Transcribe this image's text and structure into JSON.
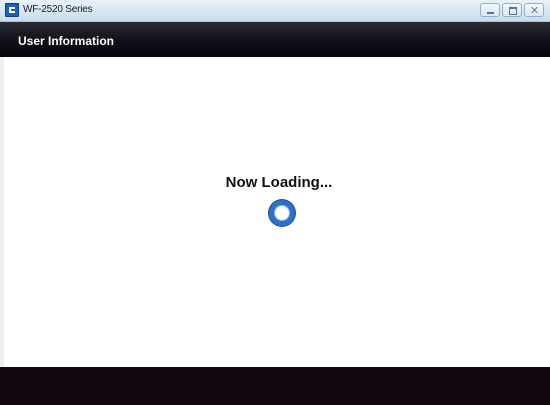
{
  "window": {
    "title": "WF-2520 Series",
    "controls": [
      "minimize",
      "maximize",
      "close"
    ]
  },
  "header": {
    "title": "User Information"
  },
  "main": {
    "status_text": "Now Loading...",
    "spinner_icon": "loading-spinner-icon"
  },
  "colors": {
    "header_background": "#0b0b12",
    "footer_background": "#12060f",
    "spinner": "#2f6fc9"
  }
}
